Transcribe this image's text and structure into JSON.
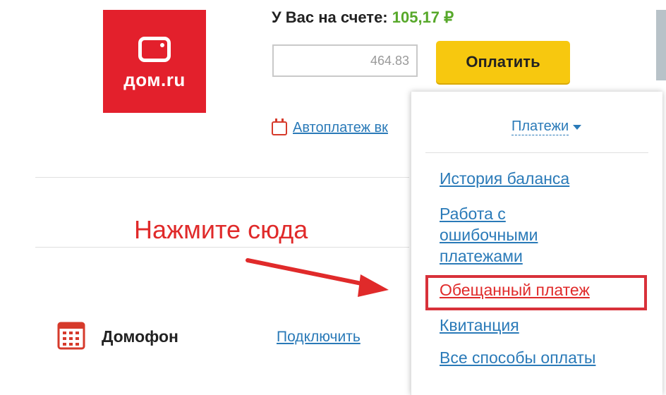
{
  "logo": {
    "text": "дом.ru"
  },
  "balance": {
    "label": "У Вас на счете:",
    "amount": "105,17 ₽"
  },
  "payment": {
    "input_value": "464.83",
    "pay_button": "Оплатить"
  },
  "autopay": {
    "link": "Автоплатеж вк"
  },
  "hint": {
    "text": "Нажмите сюда"
  },
  "services": [
    {
      "name": "Домофон",
      "action": "Подключить"
    }
  ],
  "menu": {
    "title": "Платежи",
    "items": [
      "История баланса",
      "Работа с",
      "ошибочными",
      "платежами",
      "Обещанный платеж",
      "Квитанция",
      "Все способы оплаты"
    ],
    "active_item": "Обещанный платеж"
  },
  "colors": {
    "brand_red": "#e3202c",
    "pay_yellow": "#f7c80f",
    "link_blue": "#2a7ab8",
    "hint_red": "#e02a2a",
    "balance_green": "#57a82a"
  }
}
